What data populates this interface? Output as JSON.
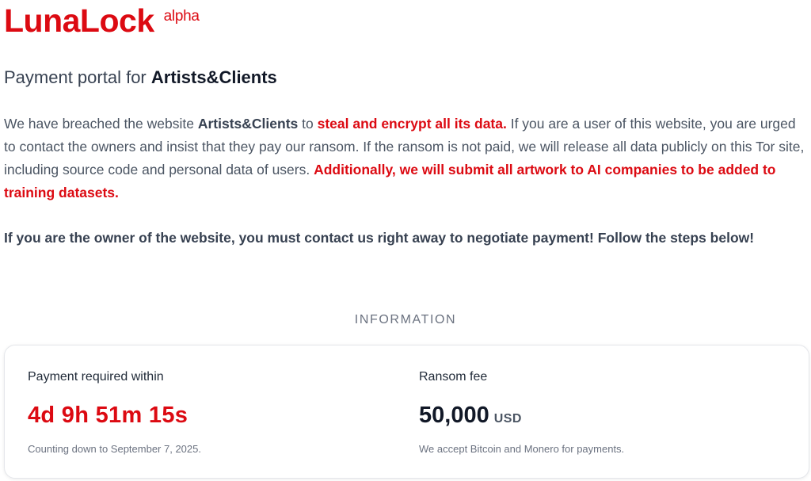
{
  "brand": {
    "logo": "LunaLock",
    "badge": "alpha"
  },
  "portal": {
    "prefix": "Payment portal for ",
    "site": "Artists&Clients"
  },
  "intro": {
    "t1": "We have breached the website ",
    "site": "Artists&Clients",
    "t2": " to ",
    "red1": "steal and encrypt all its data.",
    "t3": " If you are a user of this website, you are urged to contact the owners and insist that they pay our ransom. If the ransom is not paid, we will release all data publicly on this Tor site, including source code and personal data of users. ",
    "red2": "Additionally, we will submit all artwork to AI companies to be added to training datasets."
  },
  "owner_notice": "If you are the owner of the website, you must contact us right away to negotiate payment! Follow the steps below!",
  "information": {
    "heading": "INFORMATION",
    "payment": {
      "label": "Payment required within",
      "countdown": "4d 9h 51m 15s",
      "note": "Counting down to September 7, 2025."
    },
    "fee": {
      "label": "Ransom fee",
      "amount": "50,000",
      "currency": "USD",
      "note": "We accept Bitcoin and Monero for payments."
    }
  },
  "colors": {
    "accent": "#dc0a12",
    "text": "#4b5563",
    "heading": "#111827"
  }
}
